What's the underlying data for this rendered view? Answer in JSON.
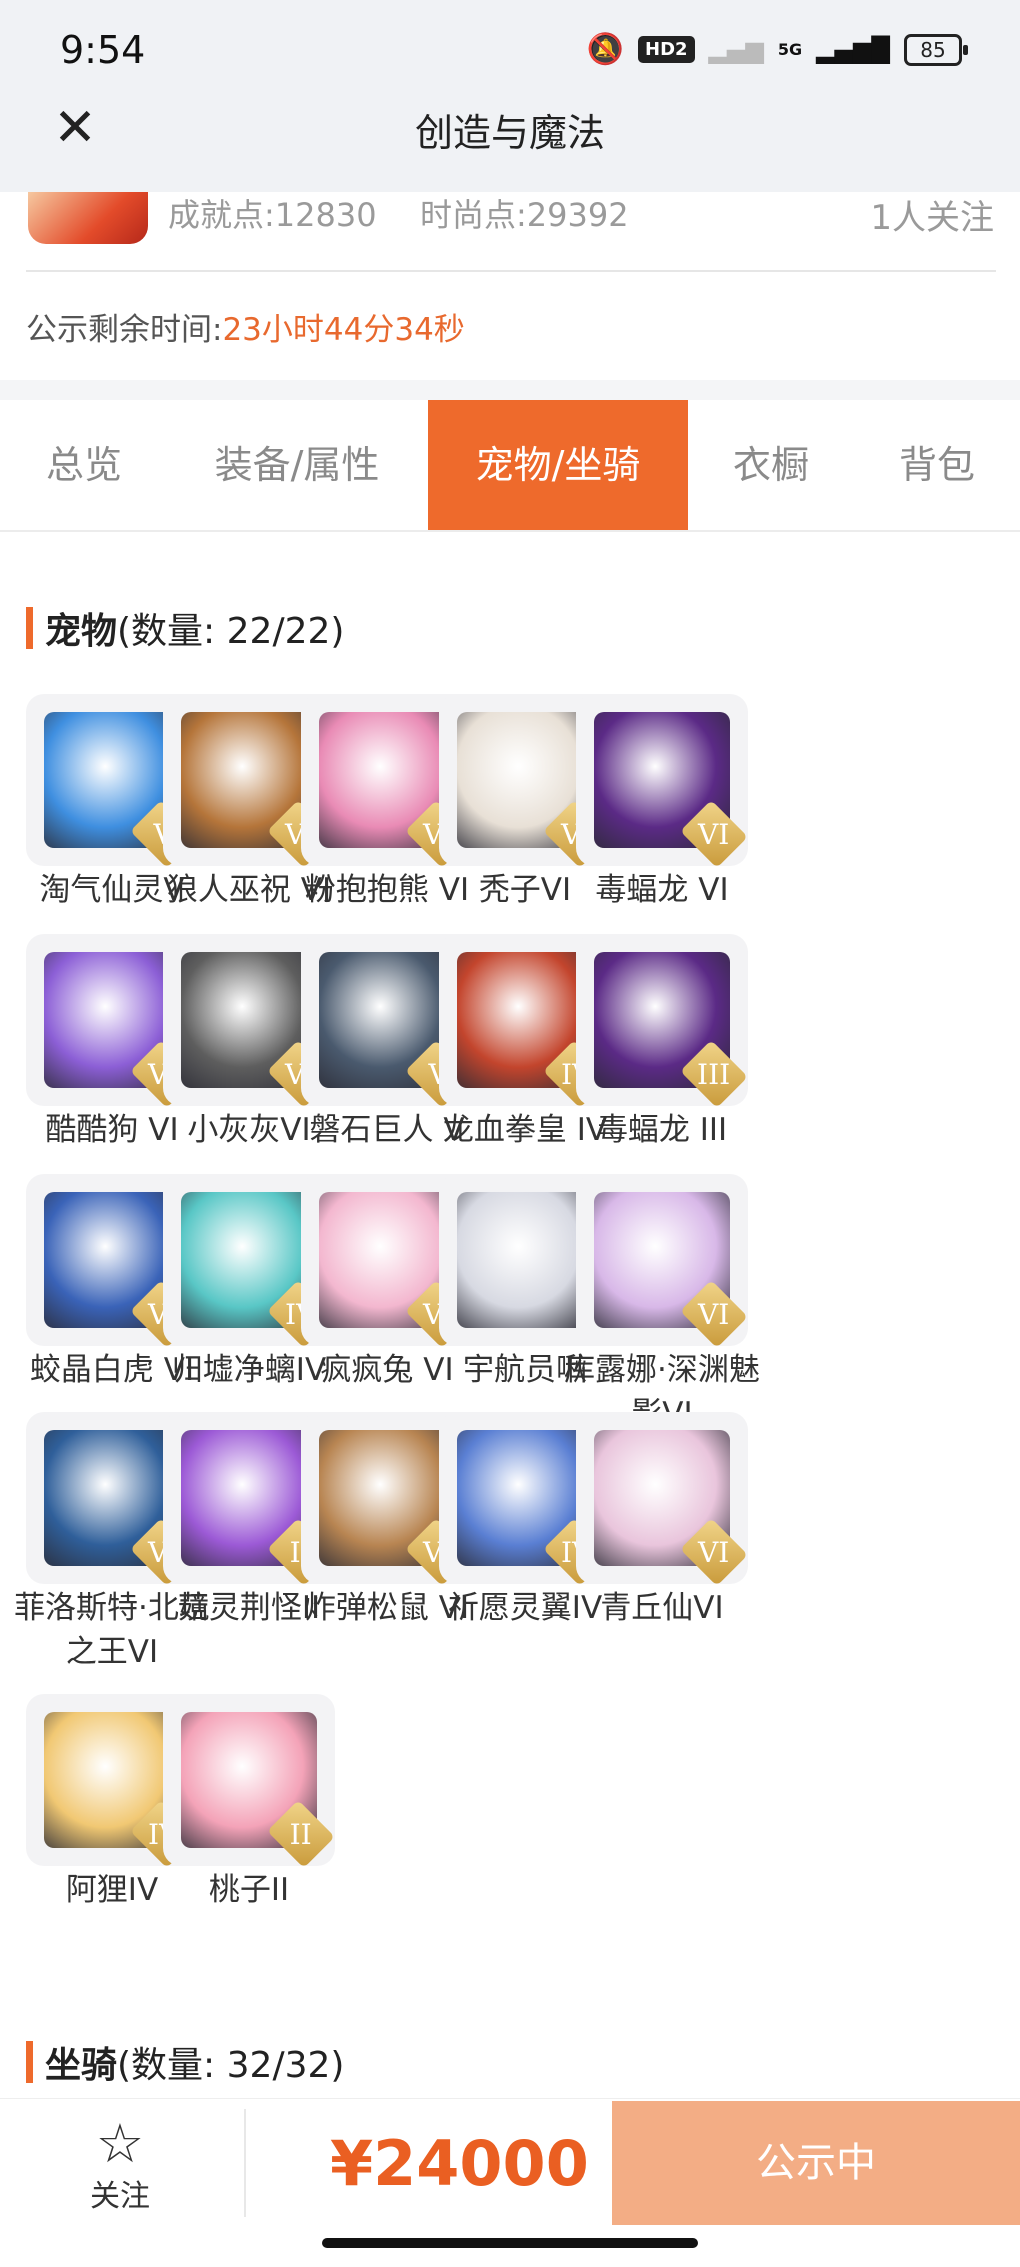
{
  "status_bar": {
    "time": "9:54",
    "hd_label": "HD2",
    "net_label": "5G",
    "battery": "85"
  },
  "header": {
    "title": "创造与魔法"
  },
  "seller": {
    "achievement": "成就点:12830",
    "fashion": "时尚点:29392",
    "followers": "1人关注"
  },
  "countdown": {
    "label": "公示剩余时间:",
    "value": "23小时44分34秒"
  },
  "tabs": [
    {
      "label": "总览",
      "active": false
    },
    {
      "label": "装备/属性",
      "active": false
    },
    {
      "label": "宠物/坐骑",
      "active": true
    },
    {
      "label": "衣橱",
      "active": false
    },
    {
      "label": "背包",
      "active": false
    }
  ],
  "pets_section": {
    "title": "宠物",
    "count": "(数量: 22/22)"
  },
  "pets": [
    {
      "name": "淘气仙灵V",
      "rank": "V",
      "color": "#3f8fe0"
    },
    {
      "name": "狼人巫祝 VI",
      "rank": "VI",
      "color": "#b5753a"
    },
    {
      "name": "粉抱抱熊 VI",
      "rank": "VI",
      "color": "#e98bb5"
    },
    {
      "name": "秃子VI",
      "rank": "VI",
      "color": "#e8e0d6"
    },
    {
      "name": "毒蝠龙 VI",
      "rank": "VI",
      "color": "#5b2a86"
    },
    {
      "name": "酷酷狗 VI",
      "rank": "VI",
      "color": "#8c5fd6"
    },
    {
      "name": "小灰灰VI",
      "rank": "VI",
      "color": "#5e5e5e"
    },
    {
      "name": "磐石巨人 V",
      "rank": "V",
      "color": "#4a5a6e"
    },
    {
      "name": "龙血拳皇 IV",
      "rank": "IV",
      "color": "#c3452d"
    },
    {
      "name": "毒蝠龙 III",
      "rank": "III",
      "color": "#5b2a86"
    },
    {
      "name": "蛟晶白虎 VI",
      "rank": "VI",
      "color": "#3a63b8"
    },
    {
      "name": "归墟净螭IV",
      "rank": "IV",
      "color": "#59c7c6"
    },
    {
      "name": "疯疯兔 VI",
      "rank": "VI",
      "color": "#f3b7cf"
    },
    {
      "name": "宇航员啾",
      "rank": "",
      "color": "#d7d9e2"
    },
    {
      "name": "库露娜·深渊魅影VI",
      "rank": "VI",
      "color": "#d8b8e8"
    },
    {
      "name": "菲洛斯特·北境之王VI",
      "rank": "VI",
      "color": "#2f5f9a"
    },
    {
      "name": "菇灵荆怪II",
      "rank": "II",
      "color": "#9c5ad6"
    },
    {
      "name": "炸弹松鼠 VI",
      "rank": "VI",
      "color": "#b88552"
    },
    {
      "name": "祈愿灵翼IV",
      "rank": "IV",
      "color": "#5a7fd3"
    },
    {
      "name": "青丘仙VI",
      "rank": "VI",
      "color": "#e9c5dc"
    },
    {
      "name": "阿狸IV",
      "rank": "IV",
      "color": "#f1c873"
    },
    {
      "name": "桃子II",
      "rank": "II",
      "color": "#f4a3b8"
    }
  ],
  "mounts_section": {
    "title": "坐骑",
    "count": "(数量: 32/32)"
  },
  "bottom": {
    "follow_label": "关注",
    "price": "¥24000",
    "status_label": "公示中"
  }
}
